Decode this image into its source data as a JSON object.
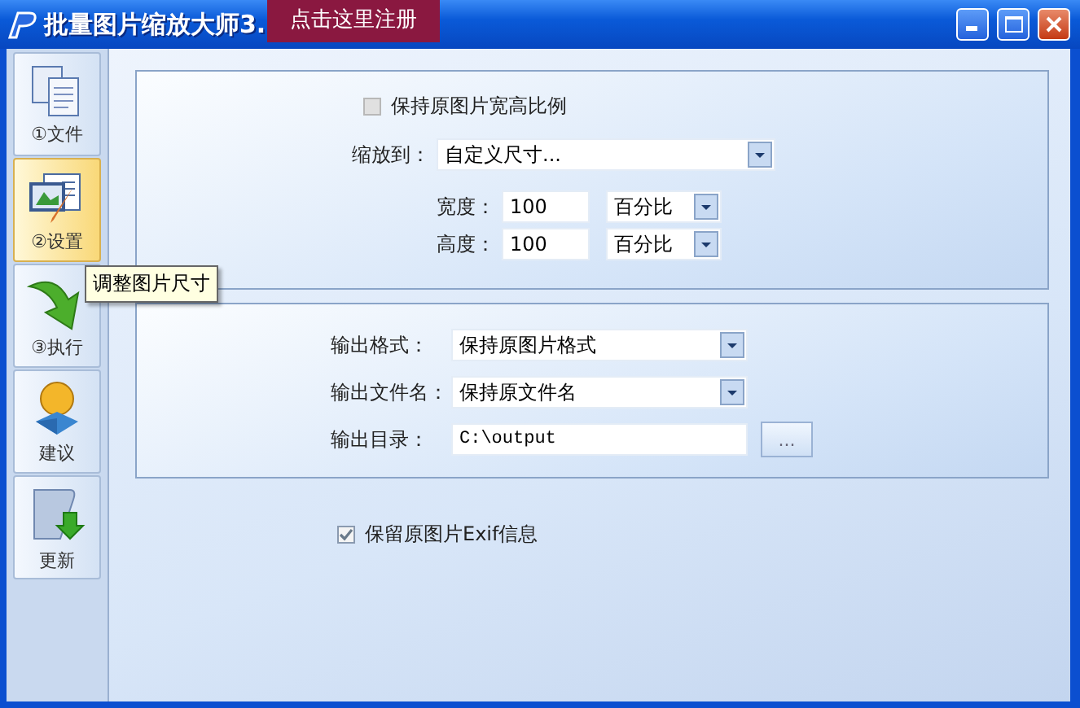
{
  "window": {
    "title": "批量图片缩放大师3.",
    "register_button": "点击这里注册"
  },
  "sidebar": {
    "items": [
      {
        "kind": "documents",
        "label": "①文件",
        "selected": false
      },
      {
        "kind": "settings",
        "label": "②设置",
        "selected": true
      },
      {
        "kind": "arrow",
        "label": "③执行",
        "selected": false
      },
      {
        "kind": "figure",
        "label": "建议",
        "selected": false
      },
      {
        "kind": "update",
        "label": "更新",
        "selected": false
      }
    ]
  },
  "tooltip": "调整图片尺寸",
  "size_panel": {
    "keep_ratio": {
      "label": "保持原图片宽高比例",
      "checked": false,
      "disabled": true
    },
    "rows": [
      {
        "kind": "select",
        "label": "缩放到：",
        "value": "自定义尺寸..."
      },
      {
        "kind": "pair",
        "label": "宽度：",
        "value": "100",
        "unit": "百分比"
      },
      {
        "kind": "pair",
        "label": "高度：",
        "value": "100",
        "unit": "百分比"
      }
    ]
  },
  "output_panel": {
    "rows": [
      {
        "kind": "select",
        "label": "输出格式：",
        "value": "保持原图片格式"
      },
      {
        "kind": "select",
        "label": "输出文件名：",
        "value": "保持原文件名"
      },
      {
        "kind": "browse",
        "label": "输出目录：",
        "value": "C:\\output",
        "button": "..."
      }
    ]
  },
  "keep_exif": {
    "label": "保留原图片Exif信息",
    "checked": true,
    "disabled": false
  }
}
